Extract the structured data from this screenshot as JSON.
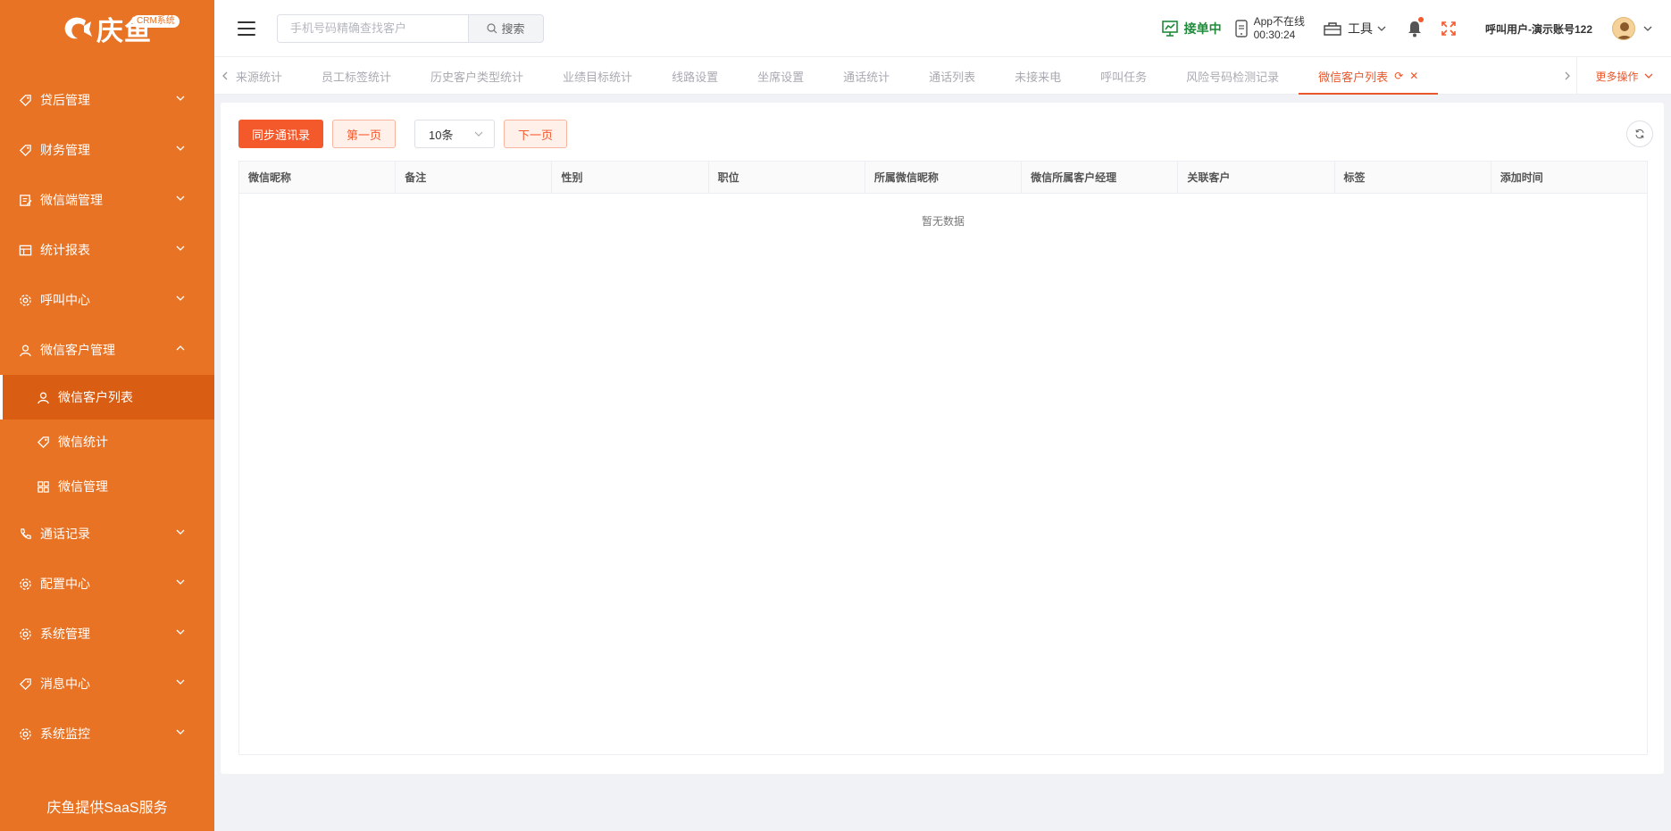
{
  "brand": {
    "name": "庆鱼",
    "badge": "CRM系统",
    "footer": "庆鱼提供SaaS服务"
  },
  "sidebar": {
    "items": [
      {
        "label": "贷后管理",
        "icon": "tag-icon"
      },
      {
        "label": "财务管理",
        "icon": "tag-icon"
      },
      {
        "label": "微信端管理",
        "icon": "edit-icon"
      },
      {
        "label": "统计报表",
        "icon": "table-icon"
      },
      {
        "label": "呼叫中心",
        "icon": "gear-icon"
      },
      {
        "label": "微信客户管理",
        "icon": "user-icon",
        "expanded": true,
        "children": [
          {
            "label": "微信客户列表",
            "icon": "user-icon",
            "active": true
          },
          {
            "label": "微信统计",
            "icon": "tag-icon"
          },
          {
            "label": "微信管理",
            "icon": "grid-icon"
          }
        ]
      },
      {
        "label": "通话记录",
        "icon": "phone-icon"
      },
      {
        "label": "配置中心",
        "icon": "gear-icon"
      },
      {
        "label": "系统管理",
        "icon": "gear-icon"
      },
      {
        "label": "消息中心",
        "icon": "tag-icon"
      },
      {
        "label": "系统监控",
        "icon": "gear-icon"
      }
    ]
  },
  "header": {
    "search": {
      "placeholder": "手机号码精确查找客户",
      "value": "",
      "button": "搜索"
    },
    "status": "接单中",
    "app_status": "App不在线",
    "app_timer": "00:30:24",
    "tools": "工具",
    "user": "呼叫用户-演示账号122"
  },
  "tabs": {
    "items": [
      {
        "label": "来源统计"
      },
      {
        "label": "员工标签统计"
      },
      {
        "label": "历史客户类型统计"
      },
      {
        "label": "业绩目标统计"
      },
      {
        "label": "线路设置"
      },
      {
        "label": "坐席设置"
      },
      {
        "label": "通话统计"
      },
      {
        "label": "通话列表"
      },
      {
        "label": "未接来电"
      },
      {
        "label": "呼叫任务"
      },
      {
        "label": "风险号码检测记录"
      },
      {
        "label": "微信客户列表",
        "active": true
      }
    ],
    "more": "更多操作"
  },
  "toolbar": {
    "sync": "同步通讯录",
    "first_page": "第一页",
    "page_size": "10条",
    "next_page": "下一页"
  },
  "table": {
    "columns": [
      "微信昵称",
      "备注",
      "性别",
      "职位",
      "所属微信昵称",
      "微信所属客户经理",
      "关联客户",
      "标签",
      "添加时间"
    ],
    "rows": [],
    "empty_text": "暂无数据"
  },
  "colors": {
    "sidebar": "#e87324",
    "sidebar_active": "#d95e14",
    "accent": "#f4592c",
    "online": "#1e8a3a"
  }
}
